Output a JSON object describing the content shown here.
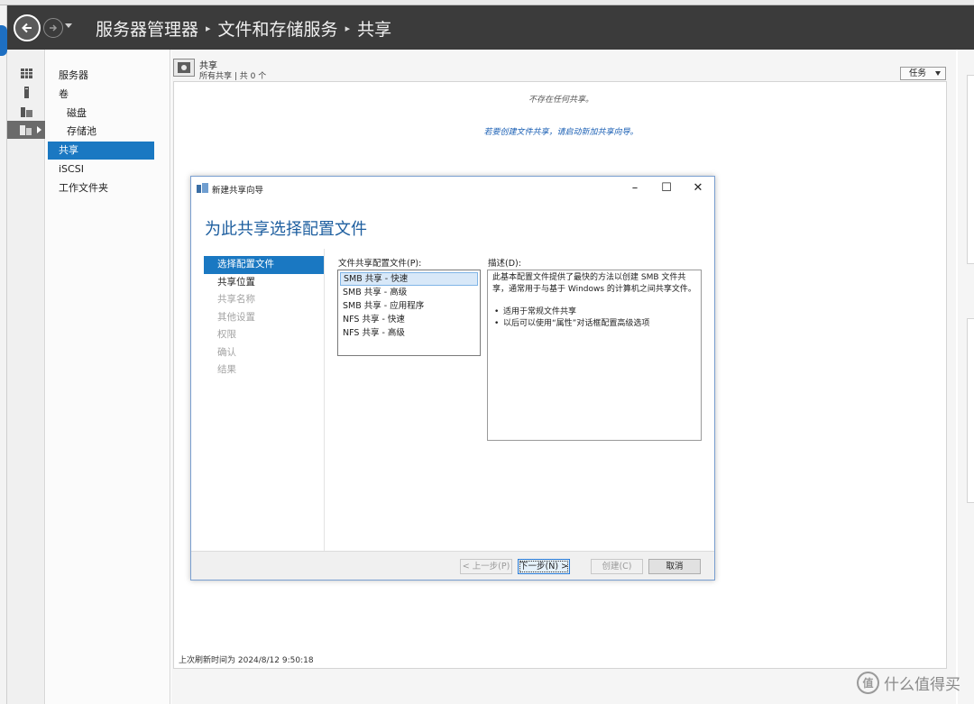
{
  "titlebar": {
    "breadcrumb": [
      "服务器管理器",
      "文件和存储服务",
      "共享"
    ]
  },
  "nav": {
    "items": [
      {
        "label": "服务器"
      },
      {
        "label": "卷"
      },
      {
        "label": "磁盘"
      },
      {
        "label": "存储池"
      },
      {
        "label": "共享"
      },
      {
        "label": "iSCSI"
      },
      {
        "label": "工作文件夹"
      }
    ]
  },
  "shares": {
    "title": "共享",
    "subtitle": "所有共享 | 共 0 个",
    "tasks_label": "任务",
    "empty_message": "不存在任何共享。",
    "create_link": "若要创建文件共享，请启动新加共享向导。",
    "last_refresh": "上次刷新时间为 2024/8/12 9:50:18"
  },
  "dialog": {
    "window_title": "新建共享向导",
    "heading": "为此共享选择配置文件",
    "steps": [
      {
        "label": "选择配置文件",
        "state": "active"
      },
      {
        "label": "共享位置",
        "state": "enabled"
      },
      {
        "label": "共享名称",
        "state": "disabled"
      },
      {
        "label": "其他设置",
        "state": "disabled"
      },
      {
        "label": "权限",
        "state": "disabled"
      },
      {
        "label": "确认",
        "state": "disabled"
      },
      {
        "label": "结果",
        "state": "disabled"
      }
    ],
    "profile_list_label": "文件共享配置文件(P):",
    "profiles": [
      {
        "label": "SMB 共享 - 快速",
        "selected": true
      },
      {
        "label": "SMB 共享 - 高级",
        "selected": false
      },
      {
        "label": "SMB 共享 - 应用程序",
        "selected": false
      },
      {
        "label": "NFS 共享 - 快速",
        "selected": false
      },
      {
        "label": "NFS 共享 - 高级",
        "selected": false
      }
    ],
    "description_label": "描述(D):",
    "description_text": "此基本配置文件提供了最快的方法以创建 SMB 文件共享，通常用于与基于 Windows 的计算机之间共享文件。",
    "description_bullets": [
      "适用于常规文件共享",
      "以后可以使用“属性”对话框配置高级选项"
    ],
    "buttons": {
      "prev": "< 上一步(P)",
      "next": "下一步(N) >",
      "create": "创建(C)",
      "cancel": "取消"
    }
  },
  "watermark": {
    "text": "什么值得买",
    "badge": "值"
  },
  "colors": {
    "accent": "#1a78c2",
    "titlebar": "#3b3b3b",
    "heading": "#1d5e9f",
    "link": "#1a5fb4"
  }
}
